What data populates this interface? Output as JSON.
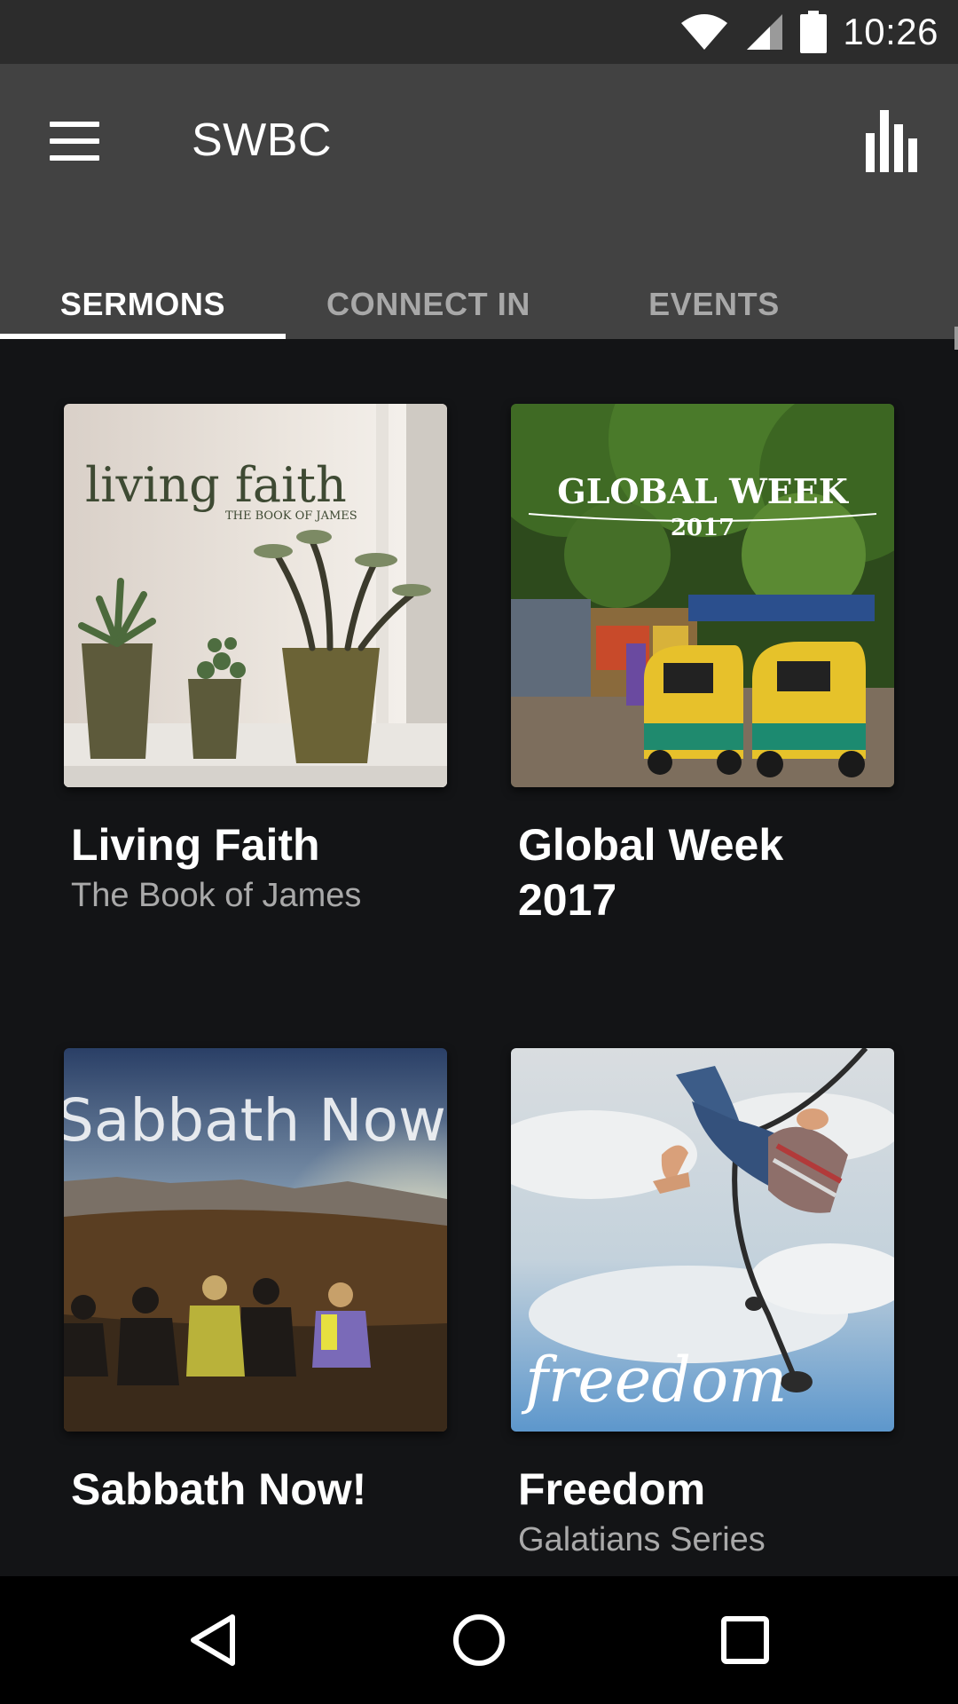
{
  "status_bar": {
    "time": "10:26"
  },
  "app_bar": {
    "title": "SWBC"
  },
  "tabs": [
    {
      "label": "SERMONS",
      "active": true
    },
    {
      "label": "CONNECT IN",
      "active": false
    },
    {
      "label": "EVENTS",
      "active": false
    }
  ],
  "sermons": [
    {
      "title": "Living Faith",
      "subtitle": "The Book of James",
      "art_text": "living faith",
      "art_subtext": "THE BOOK OF JAMES"
    },
    {
      "title": "Global Week 2017",
      "subtitle": "",
      "art_text": "GLOBAL WEEK",
      "art_subtext": "2017"
    },
    {
      "title": "Sabbath Now!",
      "subtitle": "",
      "art_text": "Sabbath Now"
    },
    {
      "title": "Freedom",
      "subtitle": "Galatians Series",
      "art_text": "freedom"
    }
  ],
  "nav_bar": {
    "icons": [
      "back-icon",
      "home-icon",
      "recents-icon"
    ]
  }
}
